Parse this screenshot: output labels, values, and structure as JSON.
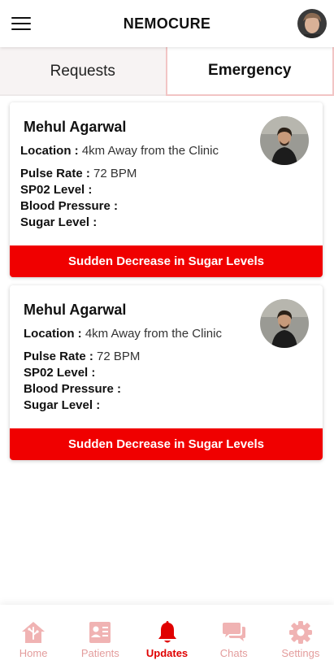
{
  "header": {
    "title": "NEMOCURE"
  },
  "tabs": [
    {
      "label": "Requests"
    },
    {
      "label": "Emergency"
    }
  ],
  "cards": [
    {
      "name": "Mehul Agarwal",
      "location_label": "Location :",
      "location_value": "4km Away from the Clinic",
      "pulse_label": "Pulse Rate :",
      "pulse_value": "72 BPM",
      "spo2_label": "SP02 Level :",
      "spo2_value": "",
      "bp_label": "Blood Pressure :",
      "bp_value": "",
      "sugar_label": "Sugar Level :",
      "sugar_value": "",
      "alert": "Sudden Decrease in Sugar Levels"
    },
    {
      "name": "Mehul Agarwal",
      "location_label": "Location :",
      "location_value": "4km Away from the Clinic",
      "pulse_label": "Pulse Rate :",
      "pulse_value": "72 BPM",
      "spo2_label": "SP02 Level :",
      "spo2_value": "",
      "bp_label": "Blood Pressure :",
      "bp_value": "",
      "sugar_label": "Sugar Level :",
      "sugar_value": "",
      "alert": "Sudden Decrease in Sugar Levels"
    }
  ],
  "nav": [
    {
      "label": "Home",
      "icon": "home-icon"
    },
    {
      "label": "Patients",
      "icon": "patients-icon"
    },
    {
      "label": "Updates",
      "icon": "bell-icon"
    },
    {
      "label": "Chats",
      "icon": "chat-icon"
    },
    {
      "label": "Settings",
      "icon": "gear-icon"
    }
  ],
  "colors": {
    "accent": "#f00000",
    "inactive_nav": "#e39c9c",
    "tab_border": "#f2c5c5"
  }
}
